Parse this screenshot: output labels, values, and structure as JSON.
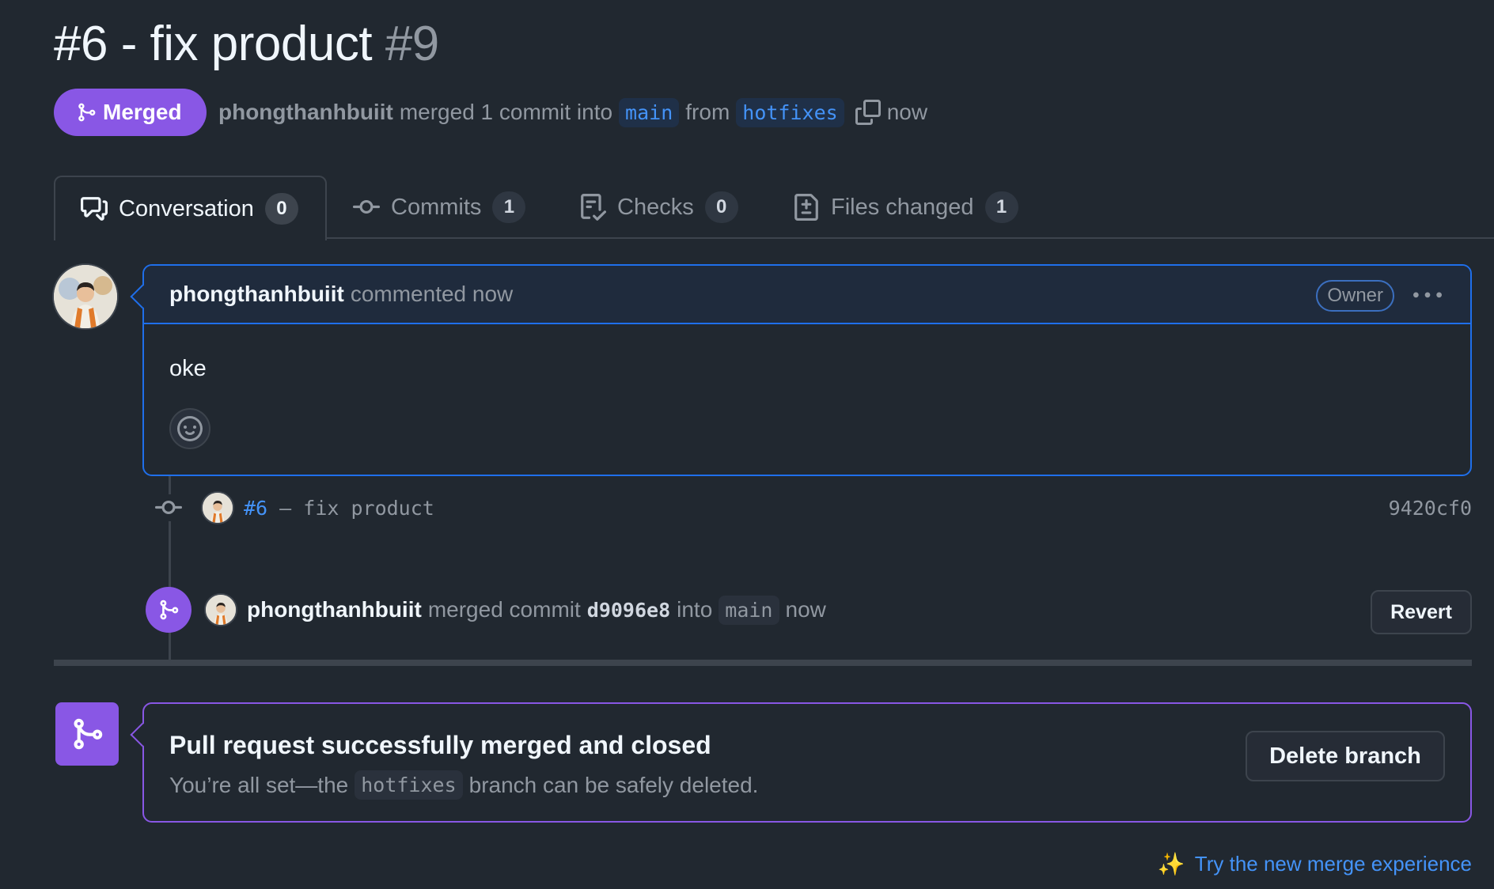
{
  "pr": {
    "title": "#6 - fix product",
    "number": "#9",
    "state_label": "Merged",
    "author": "phongthanhbuiit",
    "merge_text": "merged 1 commit into",
    "base_branch": "main",
    "from_text": "from",
    "head_branch": "hotfixes",
    "time": "now"
  },
  "tabs": [
    {
      "label": "Conversation",
      "count": "0",
      "icon": "comment-discussion-icon"
    },
    {
      "label": "Commits",
      "count": "1",
      "icon": "git-commit-icon"
    },
    {
      "label": "Checks",
      "count": "0",
      "icon": "checklist-icon"
    },
    {
      "label": "Files changed",
      "count": "1",
      "icon": "file-diff-icon"
    }
  ],
  "comment": {
    "author": "phongthanhbuiit",
    "action": "commented now",
    "role_badge": "Owner",
    "body": "oke"
  },
  "commit": {
    "link": "#6",
    "message": " – fix product",
    "sha": "9420cf0"
  },
  "merge_event": {
    "author": "phongthanhbuiit",
    "text": "merged commit",
    "sha": "d9096e8",
    "into": "into",
    "branch": "main",
    "time": "now",
    "revert_label": "Revert"
  },
  "merged_box": {
    "title": "Pull request successfully merged and closed",
    "sub_before": "You’re all set—the",
    "branch": "hotfixes",
    "sub_after": "branch can be safely deleted.",
    "delete_label": "Delete branch"
  },
  "footer": {
    "try_new": "Try the new merge experience",
    "sparkle": "✨"
  },
  "colors": {
    "background": "#212830",
    "merged_purple": "#8957e5",
    "link_blue": "#4493f8",
    "accent_border": "#1f6feb"
  }
}
